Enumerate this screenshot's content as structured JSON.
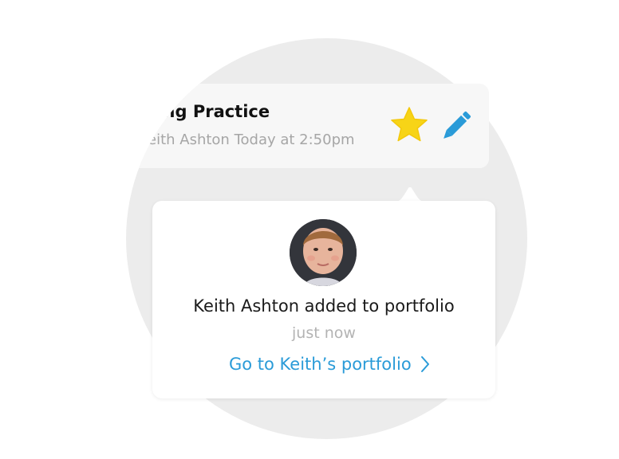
{
  "post": {
    "title": "sive Writing Practice",
    "meta": "eith Ashton Today at 2:50pm",
    "star_icon": "star-icon",
    "edit_icon": "pencil-icon"
  },
  "popover": {
    "avatar_icon": "student-avatar",
    "headline": "Keith Ashton added to portfolio",
    "time": "just now",
    "link_label": "Go to Keith’s portfolio",
    "link_icon": "chevron-right-icon"
  },
  "colors": {
    "background_circle": "#ececec",
    "card": "#f7f7f7",
    "star": "#f7d417",
    "pencil": "#2a9bd8",
    "link": "#2a9bd8"
  }
}
